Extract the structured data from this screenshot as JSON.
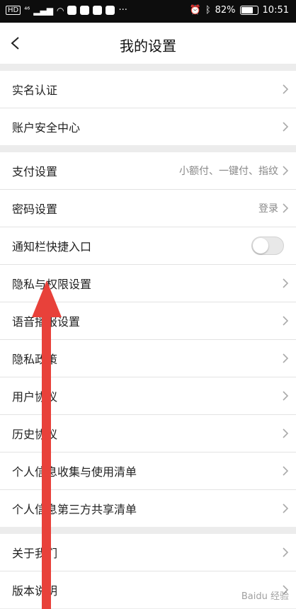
{
  "status_bar": {
    "hd": "HD",
    "signal": "⁴⁶",
    "battery_pct": "82%",
    "time": "10:51",
    "battery_fraction": 0.82
  },
  "header": {
    "title": "我的设置",
    "back_icon": "chevron-left-icon"
  },
  "groups": [
    {
      "rows": [
        {
          "label": "实名认证",
          "value": "",
          "type": "nav"
        },
        {
          "label": "账户安全中心",
          "value": "",
          "type": "nav"
        }
      ]
    },
    {
      "rows": [
        {
          "label": "支付设置",
          "value": "小额付、一键付、指纹",
          "type": "nav"
        },
        {
          "label": "密码设置",
          "value": "登录",
          "type": "nav"
        },
        {
          "label": "通知栏快捷入口",
          "value": "",
          "type": "toggle",
          "on": false
        },
        {
          "label": "隐私与权限设置",
          "value": "",
          "type": "nav"
        },
        {
          "label": "语音播报设置",
          "value": "",
          "type": "nav"
        },
        {
          "label": "隐私政策",
          "value": "",
          "type": "nav"
        },
        {
          "label": "用户协议",
          "value": "",
          "type": "nav"
        },
        {
          "label": "历史协议",
          "value": "",
          "type": "nav"
        },
        {
          "label": "个人信息收集与使用清单",
          "value": "",
          "type": "nav"
        },
        {
          "label": "个人信息第三方共享清单",
          "value": "",
          "type": "nav"
        }
      ]
    },
    {
      "rows": [
        {
          "label": "关于我们",
          "value": "",
          "type": "nav"
        },
        {
          "label": "版本说明",
          "value": "",
          "type": "nav"
        }
      ]
    }
  ],
  "annotation": {
    "color": "#e8413a"
  },
  "watermark": "Baidu 经验"
}
